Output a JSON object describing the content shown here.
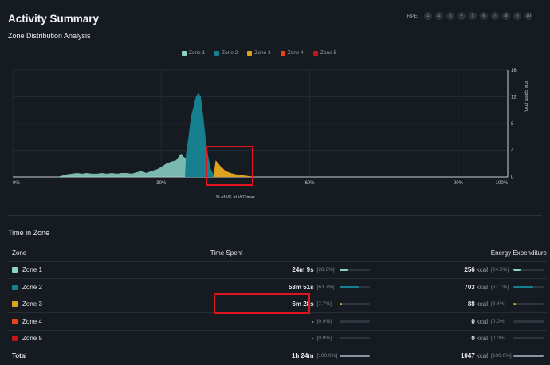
{
  "header": {
    "title": "Activity Summary",
    "subtitle": "Zone Distribution Analysis",
    "rpe_label": "RPE",
    "rpe_values": [
      "1",
      "2",
      "3",
      "4",
      "5",
      "6",
      "7",
      "8",
      "9",
      "10"
    ]
  },
  "colors": {
    "zone1": "#8dd3c7",
    "zone2": "#17808f",
    "zone3": "#e0a21c",
    "zone4": "#e8441c",
    "zone5": "#c01818",
    "highlight": "#e0141e"
  },
  "legend": [
    "Zone 1",
    "Zone 2",
    "Zone 3",
    "Zone 4",
    "Zone 5"
  ],
  "chart_data": {
    "type": "area",
    "xlabel": "% of VE at VO2max",
    "ylabel": "Time Spent (min)",
    "xlim": [
      0,
      100
    ],
    "ylim": [
      0,
      16
    ],
    "xticks": [
      "0%",
      "30%",
      "60%",
      "90%",
      "100%"
    ],
    "yticks": [
      "0",
      "4",
      "8",
      "12",
      "16"
    ],
    "series": [
      {
        "name": "Zone 1",
        "x": [
          9,
          11,
          13,
          14,
          15,
          16,
          17,
          18,
          19,
          20,
          21,
          22,
          23,
          24,
          25,
          26,
          27,
          28,
          29,
          30,
          31,
          32,
          33,
          34,
          34.5,
          35
        ],
        "y": [
          0,
          0.4,
          0.6,
          0.5,
          0.6,
          0.5,
          0.5,
          0.6,
          0.5,
          0.6,
          0.5,
          0.6,
          0.6,
          0.5,
          0.7,
          0.9,
          0.6,
          0.9,
          1.1,
          1.5,
          2,
          2.3,
          2.5,
          3.5,
          3,
          2.8
        ]
      },
      {
        "name": "Zone 2",
        "x": [
          34.8,
          35,
          35.5,
          36,
          37,
          37.5,
          38,
          38.5,
          39,
          39.5,
          40,
          40.5
        ],
        "y": [
          0,
          3.5,
          6,
          9,
          12,
          12.6,
          12,
          9,
          5.5,
          3,
          1.2,
          0.5
        ]
      },
      {
        "name": "Zone 3",
        "x": [
          40.5,
          41,
          42,
          43,
          44,
          45,
          46,
          47,
          48,
          49
        ],
        "y": [
          0,
          2.5,
          1.6,
          0.9,
          0.6,
          0.4,
          0.3,
          0.2,
          0.1,
          0
        ]
      }
    ],
    "grid": true
  },
  "table": {
    "section_title": "Time in Zone",
    "headers": {
      "zone": "Zone",
      "time": "Time Spent",
      "energy": "Energy Expenditure"
    },
    "rows": [
      {
        "zone": "Zone 1",
        "time": "24m 9s",
        "time_pct": "[28.6%]",
        "time_frac": 0.286,
        "kcal": "256",
        "kcal_unit": "kcal",
        "kcal_pct": "[24.5%]",
        "kcal_frac": 0.245
      },
      {
        "zone": "Zone 2",
        "time": "53m 51s",
        "time_pct": "[63.7%]",
        "time_frac": 0.637,
        "kcal": "703",
        "kcal_unit": "kcal",
        "kcal_pct": "[67.1%]",
        "kcal_frac": 0.671
      },
      {
        "zone": "Zone 3",
        "time": "6m 28s",
        "time_pct": "[7.7%]",
        "time_frac": 0.077,
        "kcal": "88",
        "kcal_unit": "kcal",
        "kcal_pct": "[8.4%]",
        "kcal_frac": 0.084
      },
      {
        "zone": "Zone 4",
        "time": "-",
        "time_pct": "[0.0%]",
        "time_frac": 0,
        "kcal": "0",
        "kcal_unit": "kcal",
        "kcal_pct": "[0.0%]",
        "kcal_frac": 0
      },
      {
        "zone": "Zone 5",
        "time": "-",
        "time_pct": "[0.0%]",
        "time_frac": 0,
        "kcal": "0",
        "kcal_unit": "kcal",
        "kcal_pct": "[0.0%]",
        "kcal_frac": 0
      }
    ],
    "total": {
      "label": "Total",
      "time": "1h 24m",
      "time_pct": "[100.0%]",
      "kcal": "1047",
      "kcal_unit": "kcal",
      "kcal_pct": "[100.0%]"
    }
  }
}
